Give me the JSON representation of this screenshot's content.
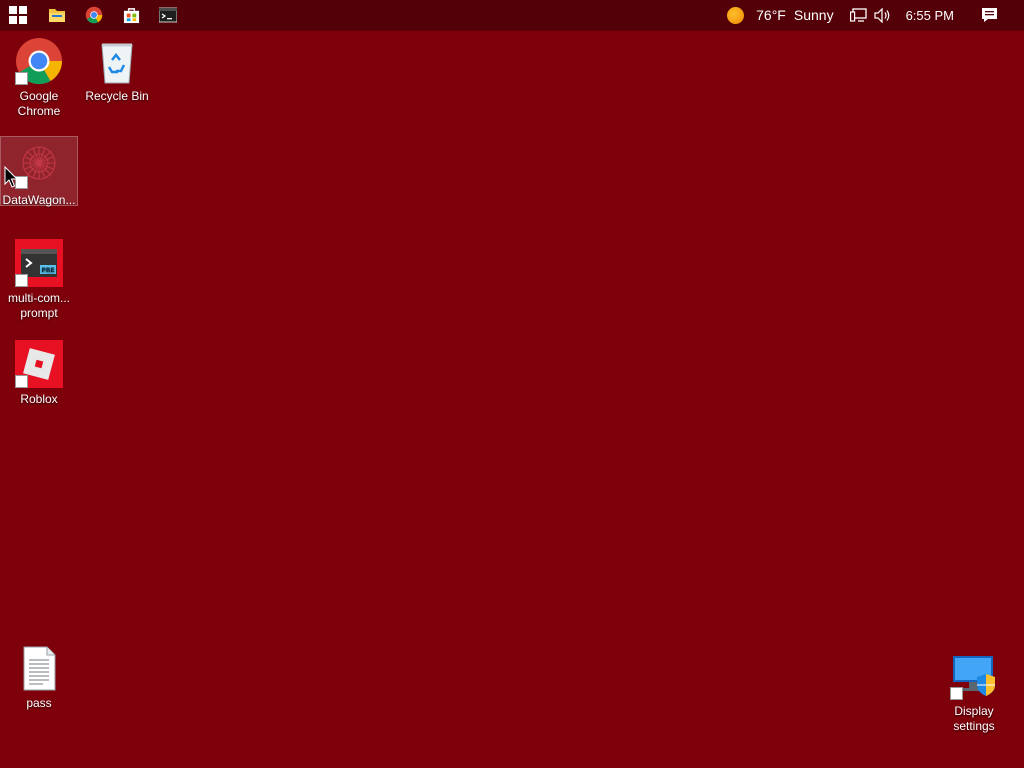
{
  "taskbar": {
    "pinned": [
      {
        "name": "start-button",
        "icon": "windows-logo-icon"
      },
      {
        "name": "file-explorer-button",
        "icon": "folder-icon"
      },
      {
        "name": "chrome-taskbar-button",
        "icon": "chrome-icon"
      },
      {
        "name": "store-button",
        "icon": "store-bag-icon"
      },
      {
        "name": "terminal-button",
        "icon": "terminal-icon"
      }
    ],
    "weather": {
      "temp": "76°F",
      "condition": "Sunny"
    },
    "clock": "6:55 PM"
  },
  "desktop": {
    "background_color": "#7e000b",
    "icons": [
      {
        "label": "Google Chrome",
        "label_lines": [
          "Google",
          "Chrome"
        ],
        "icon": "chrome-icon",
        "shortcut": true
      },
      {
        "label": "Recycle Bin",
        "label_lines": [
          "Recycle Bin"
        ],
        "icon": "recycle-bin-icon",
        "shortcut": false
      },
      {
        "label": "DataWagon...",
        "label_lines": [
          "DataWagon..."
        ],
        "icon": "datawagon-icon",
        "shortcut": true,
        "selected": true
      },
      {
        "label": "multi-com... prompt",
        "label_lines": [
          "multi-com...",
          "prompt"
        ],
        "icon": "terminal-preview-icon",
        "shortcut": true
      },
      {
        "label": "Roblox",
        "label_lines": [
          "Roblox"
        ],
        "icon": "roblox-icon",
        "shortcut": true
      },
      {
        "label": "pass",
        "label_lines": [
          "pass"
        ],
        "icon": "text-file-icon",
        "shortcut": false
      },
      {
        "label": "Display settings",
        "label_lines": [
          "Display",
          "settings"
        ],
        "icon": "display-settings-icon",
        "shortcut": true
      }
    ]
  }
}
